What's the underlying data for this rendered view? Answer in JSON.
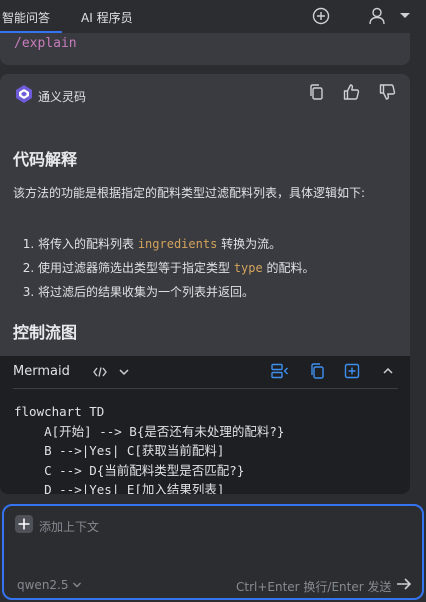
{
  "tabs": [
    {
      "label": "智能问答",
      "active": true
    },
    {
      "label": "AI 程序员",
      "active": false
    }
  ],
  "top_icons": [
    "add-circle-icon",
    "user-icon",
    "chevron-down-icon"
  ],
  "user_message": "/explain",
  "assistant": {
    "name": "通义灵码",
    "actions": [
      "copy-icon",
      "thumbs-up-icon",
      "thumbs-down-icon"
    ],
    "heading1": "代码解释",
    "intro": "该方法的功能是根据指定的配料类型过滤配料列表，具体逻辑如下:",
    "steps": [
      {
        "pre": "将传入的配料列表 ",
        "code": "ingredients",
        "post": " 转换为流。"
      },
      {
        "pre": "使用过滤器筛选出类型等于指定类型 ",
        "code": "type",
        "post": " 的配料。"
      },
      {
        "pre": "将过滤后的结果收集为一个列表并返回。",
        "code": "",
        "post": ""
      }
    ],
    "heading2": "控制流图"
  },
  "code_block": {
    "language": "Mermaid",
    "lines": [
      "flowchart TD",
      "    A[开始] --> B{是否还有未处理的配料?}",
      "    B -->|Yes| C[获取当前配料]",
      "    C --> D{当前配料类型是否匹配?}",
      "    D -->|Yes| E[加入结果列表]"
    ]
  },
  "input": {
    "add_context_label": "添加上下文",
    "model": "qwen2.5",
    "hint": "Ctrl+Enter 换行/Enter 发送"
  },
  "colors": {
    "accent": "#3574f0",
    "inline_code": "#d3a35c",
    "command": "#c77dbb"
  }
}
